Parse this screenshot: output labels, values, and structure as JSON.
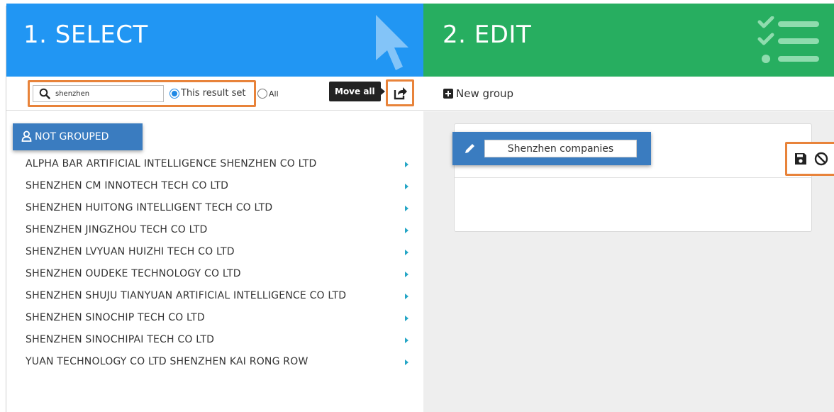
{
  "select_panel": {
    "title": "1. SELECT",
    "search": {
      "value": "shenzhen",
      "placeholder": ""
    },
    "scope_options": [
      {
        "label": "This result set",
        "selected": true
      },
      {
        "label": "All",
        "selected": false
      }
    ],
    "move_all_tooltip": "Move all",
    "not_grouped_label": "NOT GROUPED",
    "items": [
      "ALPHA BAR ARTIFICIAL INTELLIGENCE SHENZHEN CO LTD",
      "SHENZHEN CM INNOTECH TECH CO LTD",
      "SHENZHEN HUITONG INTELLIGENT TECH CO LTD",
      "SHENZHEN JINGZHOU TECH CO LTD",
      "SHENZHEN LVYUAN HUIZHI TECH CO LTD",
      "SHENZHEN OUDEKE TECHNOLOGY CO LTD",
      "SHENZHEN SHUJU TIANYUAN ARTIFICIAL INTELLIGENCE CO LTD",
      "SHENZHEN SINOCHIP TECH CO LTD",
      "SHENZHEN SINOCHIPAI TECH CO LTD",
      "YUAN TECHNOLOGY CO LTD SHENZHEN KAI RONG ROW"
    ]
  },
  "edit_panel": {
    "title": "2. EDIT",
    "new_group_label": "New group",
    "group_name": "Shenzhen companies"
  },
  "icons": {
    "header_select": "cursor-arrow-icon",
    "header_edit": "checklist-icon",
    "search": "search-icon",
    "move_all": "share-icon",
    "new_group": "plus-square-icon",
    "not_grouped": "user-icon",
    "item_expand": "caret-right-icon",
    "edit_name": "pencil-icon",
    "save": "save-icon",
    "cancel": "ban-icon"
  },
  "colors": {
    "select_header": "#2196f3",
    "edit_header": "#27ae60",
    "accent_blue": "#3a7cc0",
    "highlight_orange": "#e8833a",
    "caret_teal": "#26a6c6"
  }
}
